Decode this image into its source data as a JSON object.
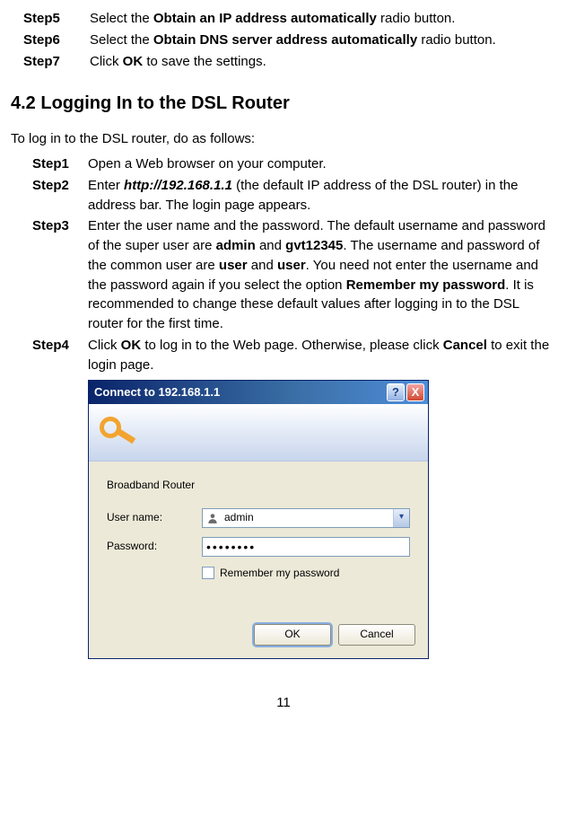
{
  "presteps": [
    {
      "label": "Step5",
      "before": "Select the ",
      "bold": "Obtain an IP address automatically",
      "after": " radio button."
    },
    {
      "label": "Step6",
      "before": "Select the ",
      "bold": "Obtain DNS server address automatically",
      "after": " radio button."
    },
    {
      "label": "Step7",
      "before": "Click ",
      "bold": "OK",
      "after": " to save the settings."
    }
  ],
  "heading": "4.2  Logging In to the DSL Router",
  "intro": "To log in to the DSL router, do as follows:",
  "steps": {
    "s1": {
      "label": "Step1",
      "text": "Open a Web browser on your computer."
    },
    "s2": {
      "label": "Step2",
      "pre": "Enter ",
      "url": "http://192.168.1.1",
      "post": " (the default IP address of the DSL router) in the address bar. The login page appears."
    },
    "s3": {
      "label": "Step3",
      "t1": "Enter the user name and the password. The default username and password of the super user are ",
      "b1": "admin",
      "t2": " and ",
      "b2": "gvt12345",
      "t3": ". The username and password of the common user are ",
      "b3": "user",
      "t4": " and ",
      "b4": "user",
      "t5": ". You need not enter the username and the password again if you select the option ",
      "b5": "Remember my password",
      "t6": ". It is recommended to change these default values after logging in to the DSL router for the first time."
    },
    "s4": {
      "label": "Step4",
      "t1": "Click ",
      "b1": "OK",
      "t2": " to log in to the Web page. Otherwise, please click ",
      "b2": "Cancel",
      "t3": " to exit the login page."
    }
  },
  "dialog": {
    "title": "Connect to 192.168.1.1",
    "help": "?",
    "close": "X",
    "router_label": "Broadband Router",
    "username_label": "User name:",
    "password_label": "Password:",
    "username_value": "admin",
    "password_value": "••••••••",
    "remember_label": "Remember my password",
    "ok": "OK",
    "cancel": "Cancel"
  },
  "page_number": "11"
}
